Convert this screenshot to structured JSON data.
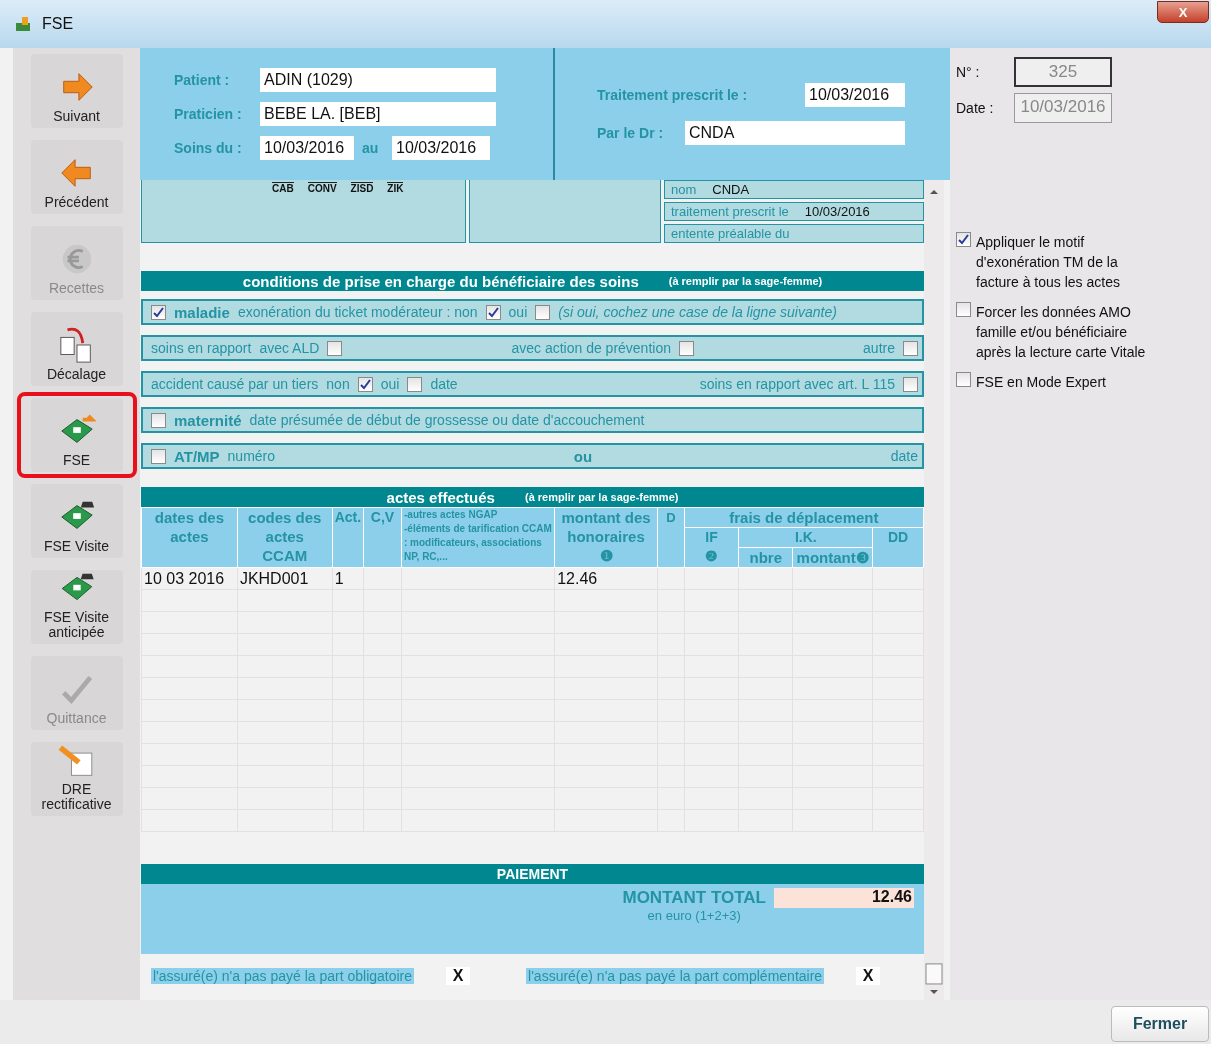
{
  "window": {
    "title": "FSE",
    "close": "X"
  },
  "sidebar": [
    {
      "label": "Suivant",
      "disabled": false,
      "highlighted": false
    },
    {
      "label": "Précédent",
      "disabled": false,
      "highlighted": false
    },
    {
      "label": "Recettes",
      "disabled": true,
      "highlighted": false
    },
    {
      "label": "Décalage",
      "disabled": false,
      "highlighted": false
    },
    {
      "label": "FSE",
      "disabled": false,
      "highlighted": true
    },
    {
      "label": "FSE Visite",
      "disabled": false,
      "highlighted": false
    },
    {
      "label": "FSE Visite anticipée",
      "disabled": false,
      "highlighted": false
    },
    {
      "label": "Quittance",
      "disabled": true,
      "highlighted": false
    },
    {
      "label": "DRE rectificative",
      "disabled": false,
      "highlighted": false
    }
  ],
  "header": {
    "left": [
      {
        "label": "Patient :",
        "value": "ADIN (1029)"
      },
      {
        "label": "Praticien :",
        "value": "BEBE LA. [BEB]"
      }
    ],
    "soins": {
      "label": "Soins du :",
      "from": "10/03/2016",
      "to_label": "au",
      "to": "10/03/2016"
    },
    "right": [
      {
        "label": "Traitement prescrit le :",
        "value": "10/03/2016"
      },
      {
        "label": "Par le Dr :",
        "value": "CNDA"
      }
    ]
  },
  "form_top": {
    "codes": [
      "CAB",
      "CONV",
      "ZISD",
      "ZIK"
    ],
    "fields": [
      {
        "label": "nom",
        "value": "CNDA"
      },
      {
        "label": "traitement prescrit le",
        "value": "10/03/2016"
      },
      {
        "label": "entente préalable du"
      }
    ]
  },
  "conditions": {
    "title": "conditions de prise en charge du bénéficiaire des soins",
    "note": "(à remplir par la sage-femme)",
    "rows": [
      {
        "groups": [
          [
            {
              "kind": "check",
              "checked": true
            },
            {
              "kind": "title",
              "text": "maladie"
            },
            {
              "kind": "text",
              "text": "exonération du ticket modérateur : non"
            },
            {
              "kind": "check",
              "checked": true
            },
            {
              "kind": "text",
              "text": "oui"
            },
            {
              "kind": "check",
              "checked": false
            },
            {
              "kind": "note",
              "text": "(si oui, cochez une case de la ligne suivante)"
            }
          ]
        ]
      },
      {
        "groups": [
          [
            {
              "kind": "text",
              "text": "soins en rapport"
            },
            {
              "kind": "text",
              "text": "avec ALD"
            },
            {
              "kind": "check",
              "checked": false
            }
          ],
          [
            {
              "kind": "text",
              "text": "avec action de prévention"
            },
            {
              "kind": "check",
              "checked": false
            }
          ],
          [
            {
              "kind": "text",
              "text": "autre"
            },
            {
              "kind": "check",
              "checked": false
            }
          ]
        ]
      },
      {
        "groups": [
          [
            {
              "kind": "text",
              "text": "accident causé par un tiers"
            },
            {
              "kind": "text",
              "text": "non"
            },
            {
              "kind": "check",
              "checked": true
            },
            {
              "kind": "text",
              "text": "oui"
            },
            {
              "kind": "check",
              "checked": false
            },
            {
              "kind": "text",
              "text": "date"
            }
          ],
          [
            {
              "kind": "text",
              "text": "soins en rapport avec art. L 115"
            },
            {
              "kind": "check",
              "checked": false
            }
          ]
        ]
      },
      {
        "groups": [
          [
            {
              "kind": "check",
              "checked": false
            },
            {
              "kind": "title",
              "text": "maternité"
            },
            {
              "kind": "text",
              "text": "date présumée de début de grossesse ou date d'accouchement"
            }
          ]
        ]
      },
      {
        "groups": [
          [
            {
              "kind": "check",
              "checked": false
            },
            {
              "kind": "title",
              "text": "AT/MP"
            },
            {
              "kind": "text",
              "text": "numéro"
            }
          ],
          [
            {
              "kind": "title",
              "text": "ou"
            }
          ],
          [
            {
              "kind": "text",
              "text": "date"
            }
          ]
        ]
      }
    ]
  },
  "actes": {
    "title": "actes effectués",
    "note": "(à remplir par la sage-femme)",
    "columns": {
      "dates": "dates des\nactes",
      "codes": "codes des\nactes\nCCAM",
      "act": "Act.",
      "cv": "C,V",
      "autres": "-autres actes NGAP\n-éléments de tarification CCAM : modificateurs, associations NP, RC,...",
      "montant": "montant des\nhonoraires\n❶",
      "d": "D",
      "frais": "frais de déplacement",
      "if": "IF\n❷",
      "ik": "I.K.",
      "dd": "DD",
      "nbre": "nbre",
      "ik_montant": "montant❸"
    },
    "rows": [
      {
        "date": "10 03 2016",
        "code": "JKHD001",
        "act": "1",
        "montant": "12.46"
      }
    ]
  },
  "paiement": {
    "title": "PAIEMENT",
    "total_label": "MONTANT TOTAL",
    "total_sub": "en euro (1+2+3)",
    "total": "12.46",
    "flags": [
      {
        "label": "l'assuré(e) n'a pas payé la part obligatoire",
        "value": "X"
      },
      {
        "label": "l'assuré(e) n'a pas payé la part complémentaire",
        "value": "X"
      }
    ]
  },
  "right_panel": {
    "number": {
      "label": "N° :",
      "value": "325"
    },
    "date": {
      "label": "Date :",
      "value": "10/03/2016"
    },
    "options": [
      {
        "label": "Appliquer le motif d'exonération TM de la facture à tous les actes",
        "checked": true
      },
      {
        "label": "Forcer les données AMO famille et/ou bénéficiaire après la lecture carte Vitale",
        "checked": false
      },
      {
        "label": "FSE en Mode Expert",
        "checked": false
      }
    ]
  },
  "buttons": [
    "Fermer"
  ]
}
